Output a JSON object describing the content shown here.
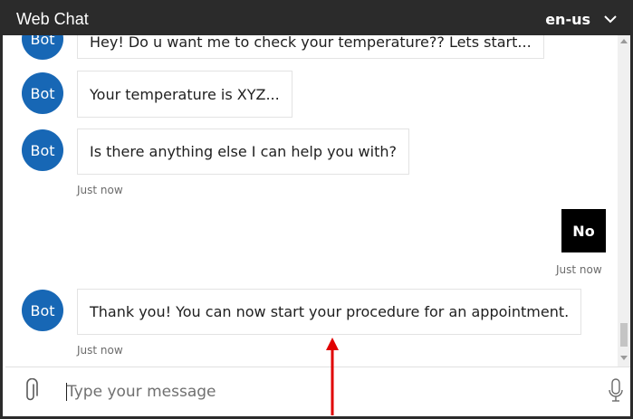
{
  "header": {
    "title": "Web Chat",
    "language": "en-us",
    "language_icon": "chevron-down-icon"
  },
  "messages": [
    {
      "from": "bot",
      "avatar": "Bot",
      "text": "Hey! Do u want me to check your temperature?? Lets start..."
    },
    {
      "from": "bot",
      "avatar": "Bot",
      "text": "Your temperature is XYZ..."
    },
    {
      "from": "bot",
      "avatar": "Bot",
      "text": "Is there anything else I can help you with?",
      "timestamp": "Just now"
    },
    {
      "from": "user",
      "text": "No",
      "timestamp": "Just now"
    },
    {
      "from": "bot",
      "avatar": "Bot",
      "text": "Thank you! You can now start your procedure for an appointment.",
      "timestamp": "Just now"
    }
  ],
  "composer": {
    "placeholder": "Type your message",
    "attach_icon": "paperclip-icon",
    "mic_icon": "microphone-icon"
  },
  "colors": {
    "header_bg": "#2b2b2b",
    "avatar_bg": "#1767b5",
    "user_bubble_bg": "#000000",
    "annotation_arrow": "#e00000"
  }
}
